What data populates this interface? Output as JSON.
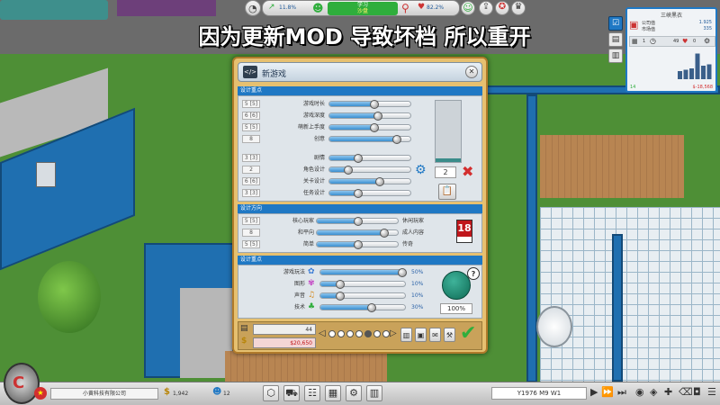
{
  "overlay_title": "因为更新MOD 导致坏档 所以重开",
  "hud": {
    "rating_pct": "11.8%",
    "season_label": "学习",
    "season_sub": "沙盘",
    "satisfaction_pct": "82.2%"
  },
  "info_panel": {
    "title": "三峡黑衣",
    "line1_label": "公司值",
    "line1_value": "1.925",
    "line2_label": "市场值",
    "line2_value": "335",
    "stat_a": "1",
    "stat_b": "49",
    "stat_c": "0",
    "money_left": "14",
    "money_right": "$-18,568",
    "bars": [
      0.3,
      0.35,
      0.4,
      0.95,
      0.5,
      0.55
    ]
  },
  "dialog": {
    "title": "新游戏",
    "section1": "设计重点",
    "section2": "设计方向",
    "section3": "设计重点",
    "sliders1": [
      {
        "level": "5 [5]",
        "label": "游戏时长",
        "value": 0.55
      },
      {
        "level": "6 [6]",
        "label": "游戏深度",
        "value": 0.6
      },
      {
        "level": "5 [5]",
        "label": "萌新上手度",
        "value": 0.55
      },
      {
        "level": "8",
        "label": "创意",
        "value": 0.85
      }
    ],
    "sliders2": [
      {
        "level": "3 [3]",
        "label": "剧情",
        "value": 0.33
      },
      {
        "level": "2",
        "label": "角色设计",
        "value": 0.2
      },
      {
        "level": "6 [6]",
        "label": "关卡设计",
        "value": 0.62
      },
      {
        "level": "3 [3]",
        "label": "任务设计",
        "value": 0.33
      }
    ],
    "direction": [
      {
        "level": "5 [5]",
        "left": "核心玩家",
        "right": "休闲玩家",
        "value": 0.5
      },
      {
        "level": "8",
        "left": "和平向",
        "right": "成人内容",
        "value": 0.85
      },
      {
        "level": "5 [5]",
        "left": "简单",
        "right": "传奇",
        "value": 0.5
      }
    ],
    "focus": [
      {
        "label": "游戏玩法",
        "pct": "50%",
        "value": 1.0
      },
      {
        "label": "图形",
        "pct": "10%",
        "value": 0.2
      },
      {
        "label": "声音",
        "pct": "10%",
        "value": 0.2
      },
      {
        "label": "技术",
        "pct": "30%",
        "value": 0.6
      }
    ],
    "side_count": "2",
    "age_rating": "18",
    "total_pct": "100%",
    "footer_value": "44",
    "footer_money": "$20,650",
    "help": "?"
  },
  "bottom": {
    "company": "小黄科技有限公司",
    "money": "1,942",
    "staff": "12",
    "date": "Y1976 M9 W1"
  },
  "colors": {
    "accent_blue": "#1f78c4",
    "dialog_gold": "#e6c070",
    "danger_red": "#d32f2f",
    "ok_green": "#2fae3c"
  }
}
